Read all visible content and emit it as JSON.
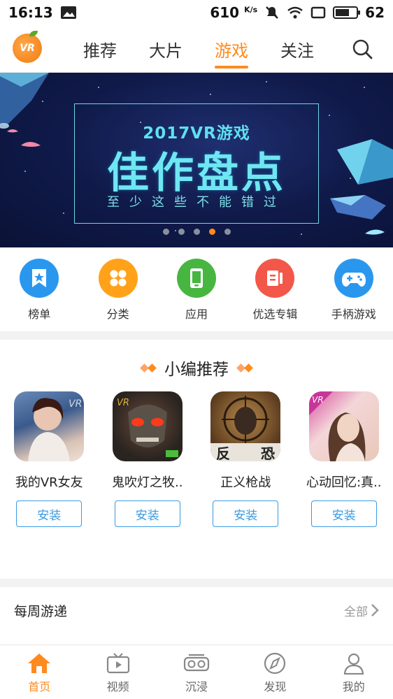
{
  "status_bar": {
    "time": "16:13",
    "net_speed": "610",
    "net_unit": "K/s",
    "battery": "62"
  },
  "top_nav": {
    "logo_text": "VR",
    "tabs": [
      {
        "label": "推荐",
        "active": false
      },
      {
        "label": "大片",
        "active": false
      },
      {
        "label": "游戏",
        "active": true
      },
      {
        "label": "关注",
        "active": false
      }
    ]
  },
  "banner": {
    "subtitle": "2017VR游戏",
    "title": "佳作盘点",
    "tagline": "至少这些不能错过",
    "page_count": 5,
    "active_page": 4
  },
  "categories": [
    {
      "label": "榜单",
      "icon": "bookmark-star-icon",
      "color": "#2a97ef"
    },
    {
      "label": "分类",
      "icon": "grid-icon",
      "color": "#ffa21a"
    },
    {
      "label": "应用",
      "icon": "phone-icon",
      "color": "#46b640"
    },
    {
      "label": "优选专辑",
      "icon": "album-icon",
      "color": "#f3574a"
    },
    {
      "label": "手柄游戏",
      "icon": "gamepad-icon",
      "color": "#2a97ef"
    }
  ],
  "recommend": {
    "title": "小编推荐",
    "apps": [
      {
        "name": "我的VR女友",
        "install": "安装"
      },
      {
        "name": "鬼吹灯之牧..",
        "install": "安装"
      },
      {
        "name": "正义枪战",
        "install": "安装"
      },
      {
        "name": "心动回忆:真..",
        "install": "安装"
      }
    ]
  },
  "weekly": {
    "title": "每周游递",
    "all_label": "全部"
  },
  "bottom_nav": [
    {
      "label": "首页",
      "icon": "home-icon",
      "active": true
    },
    {
      "label": "视频",
      "icon": "tv-icon",
      "active": false
    },
    {
      "label": "沉浸",
      "icon": "vr-headset-icon",
      "active": false
    },
    {
      "label": "发现",
      "icon": "compass-icon",
      "active": false
    },
    {
      "label": "我的",
      "icon": "user-icon",
      "active": false
    }
  ],
  "colors": {
    "accent": "#ff8a1e",
    "install_blue": "#3a9ae0"
  }
}
